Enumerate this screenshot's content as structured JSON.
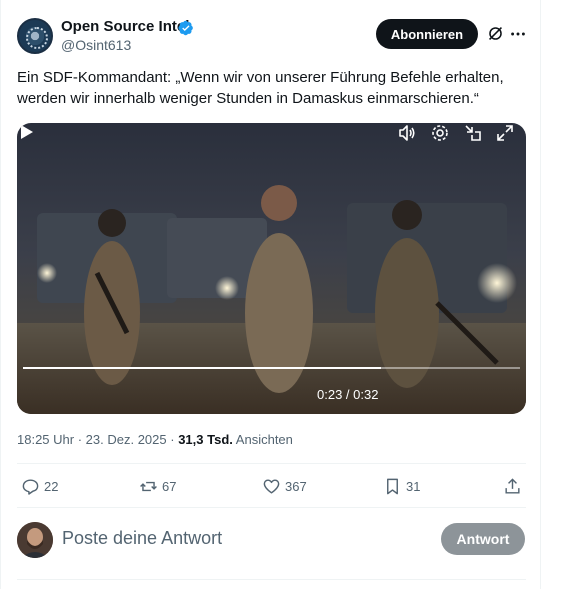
{
  "author": {
    "name": "Open Source Intel",
    "handle": "@Osint613",
    "verified": true
  },
  "header": {
    "subscribe_label": "Abonnieren",
    "icons": [
      "grok-icon",
      "more-icon"
    ]
  },
  "tweet": {
    "text_line1": "Ein SDF-Kommandant: „Wenn wir von unserer Führung Befehle erhalten,",
    "text_line2": "werden wir innerhalb weniger Stunden in Damaskus einmarschieren.“"
  },
  "video": {
    "time_display": "0:23 / 0:32",
    "progress_fraction": 0.72,
    "controls": [
      "play-icon",
      "volume-icon",
      "settings-icon",
      "minimize-icon",
      "fullscreen-icon"
    ]
  },
  "meta": {
    "time": "18:25 Uhr",
    "date": "23. Dez. 2025",
    "views_count": "31,3 Tsd.",
    "views_label": "Ansichten"
  },
  "actions": {
    "replies": "22",
    "reposts": "67",
    "likes": "367",
    "bookmarks": "31"
  },
  "reply": {
    "placeholder": "Poste deine Antwort",
    "button_label": "Antwort"
  },
  "colors": {
    "text": "#0f1419",
    "secondary": "#536471",
    "verified": "#1d9bf0",
    "button_dark": "#0f1419",
    "button_disabled": "#8d9499"
  }
}
